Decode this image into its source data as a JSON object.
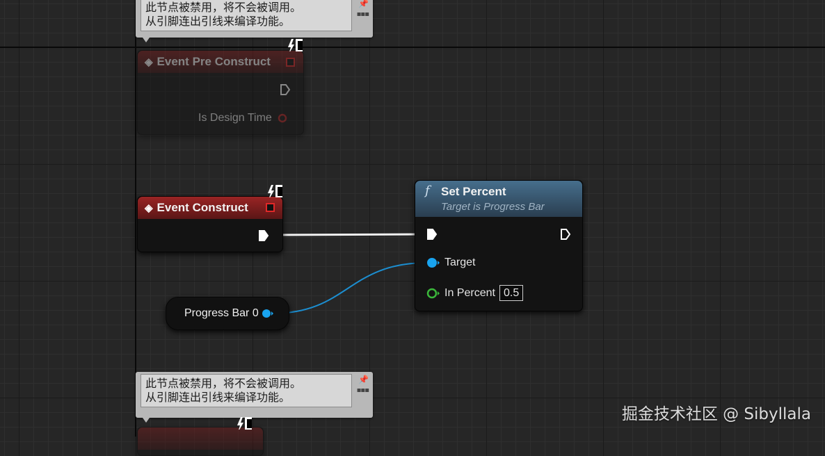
{
  "comments": [
    {
      "text": "此节点被禁用，将不会被调用。\n从引脚连出引线来编译功能。"
    },
    {
      "text": "此节点被禁用，将不会被调用。\n从引脚连出引线来编译功能。"
    }
  ],
  "nodes": {
    "event_pre_construct": {
      "title": "Event Pre Construct",
      "pins": {
        "is_design_time": "Is Design Time"
      },
      "disabled": true
    },
    "event_construct": {
      "title": "Event Construct"
    },
    "progress_bar_var": {
      "label": "Progress Bar 0"
    },
    "set_percent": {
      "title": "Set Percent",
      "subtitle": "Target is Progress Bar",
      "pins": {
        "target": "Target",
        "in_percent": "In Percent"
      },
      "in_percent_value": "0.5"
    }
  },
  "colors": {
    "event_header": "#8a1c1c",
    "function_header": "#3d5f7a",
    "object_pin": "#19a4f0",
    "float_pin": "#3bb83b",
    "exec_pin": "#ffffff",
    "delegate_pin": "#e02828"
  },
  "icons": {
    "event": "event-diamond-icon",
    "function": "function-f-icon",
    "monitor": "monitor-lightning-icon",
    "pin": "pushpin-icon"
  },
  "watermark": "掘金技术社区 @ Sibyllala"
}
